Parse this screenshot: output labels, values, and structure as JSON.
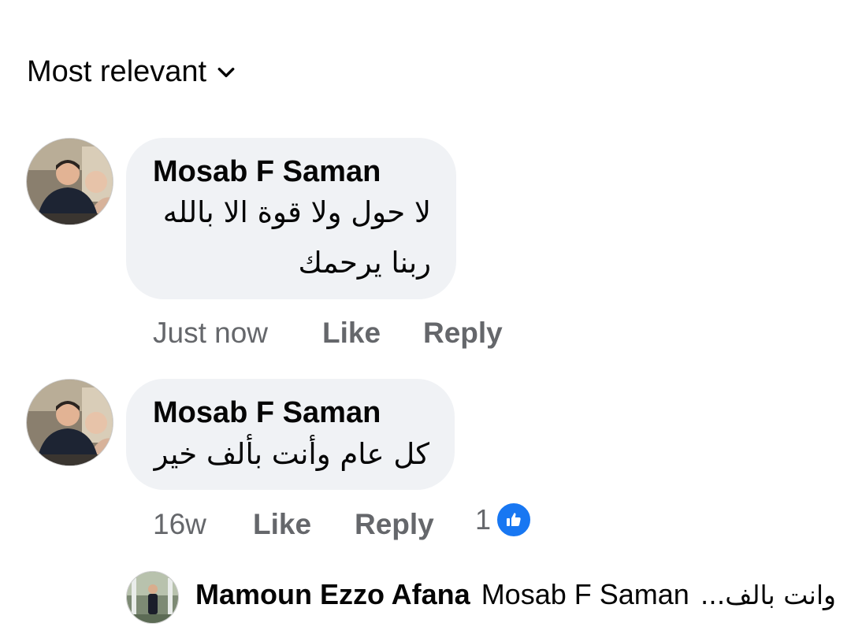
{
  "sort": {
    "label": "Most relevant",
    "icon": "chevron-down-icon"
  },
  "comments": [
    {
      "author": "Mosab F Saman",
      "lines": [
        "لا حول ولا قوة الا بالله",
        "ربنا يرحمك"
      ],
      "time": "Just now",
      "like_label": "Like",
      "reply_label": "Reply"
    },
    {
      "author": "Mosab F Saman",
      "lines": [
        "كل عام وأنت بألف خير"
      ],
      "time": "16w",
      "like_label": "Like",
      "reply_label": "Reply",
      "reactions": {
        "count": "1",
        "icon": "like-reaction-icon"
      }
    }
  ],
  "reply_preview": {
    "author": "Mamoun Ezzo Afana",
    "tagged": "Mosab F Saman",
    "text": "وانت بالف..."
  },
  "colors": {
    "bubble": "#f0f2f5",
    "muted_text": "#65676b",
    "like_blue": "#1877f2"
  }
}
